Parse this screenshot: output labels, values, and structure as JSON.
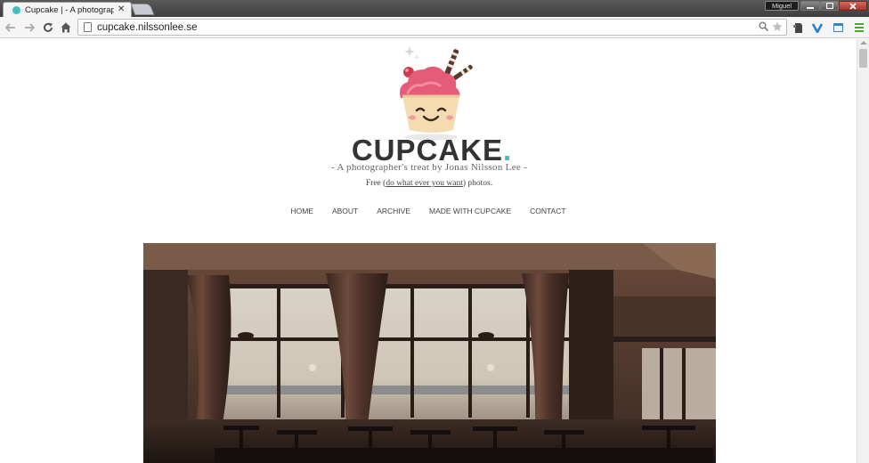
{
  "browser": {
    "tab_title": "Cupcake | - A photographer",
    "tab_close": "✕",
    "user_name": "Miguel",
    "url": "cupcake.nilssonlee.se"
  },
  "colors": {
    "accent": "#3fbfc0",
    "frosting": "#e45c78",
    "cake": "#f5dcb0",
    "text_dark": "#333333"
  },
  "site": {
    "title": "CUPCAKE",
    "title_dot": ".",
    "tagline": "- A photographer's treat by Jonas Nilsson Lee -",
    "free_prefix": "Free (",
    "free_link": "do what ever you want",
    "free_suffix": ") photos."
  },
  "nav": {
    "items": [
      {
        "label": "HOME"
      },
      {
        "label": "ABOUT"
      },
      {
        "label": "ARCHIVE"
      },
      {
        "label": "MADE WITH CUPCAKE"
      },
      {
        "label": "CONTACT"
      }
    ]
  },
  "icons": {
    "back": "arrow-left-icon",
    "forward": "arrow-right-icon",
    "reload": "reload-icon",
    "home": "home-icon",
    "search": "search-icon",
    "bookmark": "star-icon",
    "menu": "hamburger-icon"
  }
}
